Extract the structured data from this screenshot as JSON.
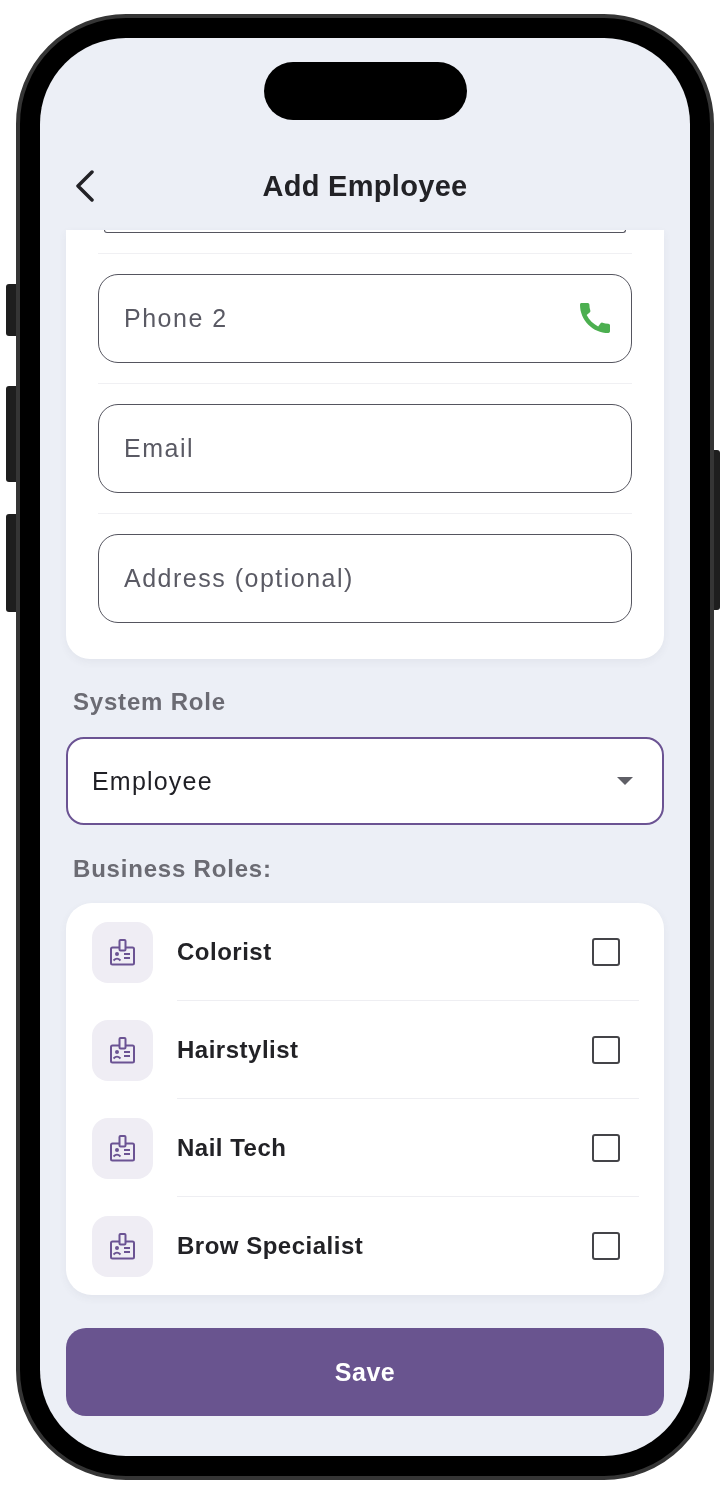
{
  "header": {
    "title": "Add Employee"
  },
  "contact_fields": [
    {
      "placeholder": "Phone 2",
      "kind": "phone"
    },
    {
      "placeholder": "Email",
      "kind": "text"
    },
    {
      "placeholder": "Address (optional)",
      "kind": "text"
    }
  ],
  "system_role": {
    "label": "System Role",
    "value": "Employee"
  },
  "business_roles": {
    "label": "Business Roles:",
    "items": [
      {
        "name": "Colorist",
        "checked": false
      },
      {
        "name": "Hairstylist",
        "checked": false
      },
      {
        "name": "Nail Tech",
        "checked": false
      },
      {
        "name": "Brow Specialist",
        "checked": false
      }
    ]
  },
  "save_button": {
    "label": "Save"
  }
}
